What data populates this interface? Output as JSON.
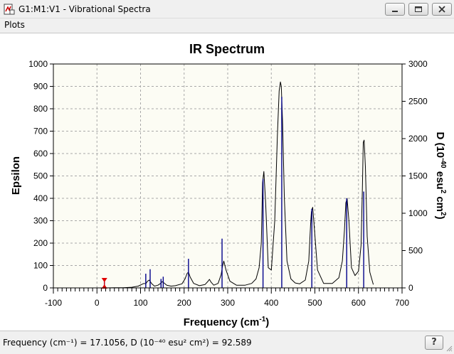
{
  "window": {
    "title": "G1:M1:V1 - Vibrational Spectra",
    "buttons": [
      "minimize",
      "maximize",
      "close"
    ]
  },
  "menu": {
    "items": [
      "Plots"
    ]
  },
  "status": {
    "text": "Frequency (cm⁻¹) = 17.1056, D (10⁻⁴⁰ esu² cm²) = 92.589",
    "help_label": "?"
  },
  "chart_data": {
    "type": "line",
    "title": "IR Spectrum",
    "xlabel": "Frequency (cm-1)",
    "ylabel": "Epsilon",
    "y2label": "D (10-40 esu2 cm2)",
    "xlim": [
      -100,
      700
    ],
    "ylim": [
      0,
      1000
    ],
    "y2lim": [
      0,
      3000
    ],
    "x_ticks": [
      -100,
      0,
      100,
      200,
      300,
      400,
      500,
      600,
      700
    ],
    "y_ticks": [
      0,
      100,
      200,
      300,
      400,
      500,
      600,
      700,
      800,
      900,
      1000
    ],
    "y2_ticks": [
      0,
      500,
      1000,
      1500,
      2000,
      2500,
      3000
    ],
    "grid": true,
    "series": [
      {
        "kind": "curve",
        "axis": "left",
        "color": "#000000",
        "x": [
          -3,
          0,
          20,
          40,
          60,
          80,
          95,
          102,
          108,
          112,
          116,
          120,
          126,
          132,
          140,
          146,
          150,
          154,
          160,
          170,
          180,
          195,
          202,
          207,
          210,
          214,
          222,
          235,
          248,
          255,
          258,
          262,
          268,
          278,
          285,
          288,
          291,
          296,
          305,
          320,
          340,
          355,
          365,
          372,
          377,
          380,
          383,
          387,
          393,
          400,
          408,
          414,
          418,
          421,
          423,
          426,
          430,
          436,
          445,
          455,
          465,
          478,
          486,
          490,
          492,
          495,
          499,
          506,
          520,
          540,
          555,
          563,
          568,
          571,
          574,
          578,
          584,
          592,
          600,
          606,
          609,
          611,
          613,
          616,
          620,
          626,
          634
        ],
        "y": [
          0,
          0,
          0,
          1,
          1,
          3,
          8,
          15,
          20,
          18,
          30,
          35,
          18,
          8,
          12,
          20,
          28,
          22,
          12,
          8,
          10,
          18,
          40,
          65,
          70,
          48,
          20,
          10,
          15,
          30,
          38,
          25,
          12,
          20,
          60,
          95,
          120,
          80,
          30,
          12,
          12,
          20,
          40,
          90,
          200,
          470,
          520,
          380,
          90,
          80,
          300,
          680,
          880,
          920,
          900,
          730,
          400,
          120,
          40,
          22,
          18,
          35,
          120,
          280,
          340,
          360,
          260,
          80,
          20,
          20,
          45,
          120,
          260,
          380,
          400,
          300,
          90,
          55,
          75,
          190,
          450,
          650,
          660,
          540,
          230,
          70,
          15
        ]
      },
      {
        "kind": "sticks",
        "axis": "right",
        "color": "#00008b",
        "x": [
          17,
          112,
          122,
          147,
          152,
          210,
          287,
          381,
          424,
          493,
          573,
          612
        ],
        "y": [
          92.589,
          190,
          250,
          120,
          150,
          390,
          660,
          1460,
          2560,
          1060,
          1200,
          1290
        ]
      }
    ],
    "marker": {
      "x": 17.1056,
      "color": "#e00000"
    }
  }
}
